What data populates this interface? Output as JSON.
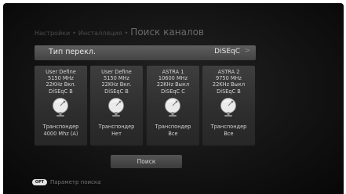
{
  "breadcrumb": {
    "items": [
      "Настройки",
      "Инсталляция"
    ],
    "separator": "•",
    "title": "Поиск каналов"
  },
  "switch_type": {
    "label": "Тип перекл.",
    "value": "DiSEqC",
    "arrow": ">"
  },
  "satellites": [
    {
      "name": "User Define",
      "freq": "5150 MHz",
      "tone": "22KHz Вкл.",
      "diseqc": "DiSEqC B",
      "tp_label": "Транспондер",
      "tp_value": "4000 Mhz (A)"
    },
    {
      "name": "User Define",
      "freq": "5150 MHz",
      "tone": "22KHz Вкл.",
      "diseqc": "DiSEqC B",
      "tp_label": "Транспондер",
      "tp_value": "Нет"
    },
    {
      "name": "ASTRA 1",
      "freq": "10600 MHz",
      "tone": "22KHz Выкл",
      "diseqc": "DiSEqC C",
      "tp_label": "Транспондер",
      "tp_value": "Все"
    },
    {
      "name": "ASTRA 2",
      "freq": "9750 MHz",
      "tone": "22KHz Выкл",
      "diseqc": "DiSEqC B",
      "tp_label": "Транспондер",
      "tp_value": "Все"
    }
  ],
  "search_button": {
    "label": "Поиск"
  },
  "hint": {
    "key_label": "OPT",
    "text": "Параметр поиска"
  },
  "icons": {
    "satellite_dish": "satellite-dish-icon"
  },
  "colors": {
    "background": "#121212",
    "panel": "#333333",
    "highlight_row": "#525252",
    "text": "#d4d4d4"
  }
}
